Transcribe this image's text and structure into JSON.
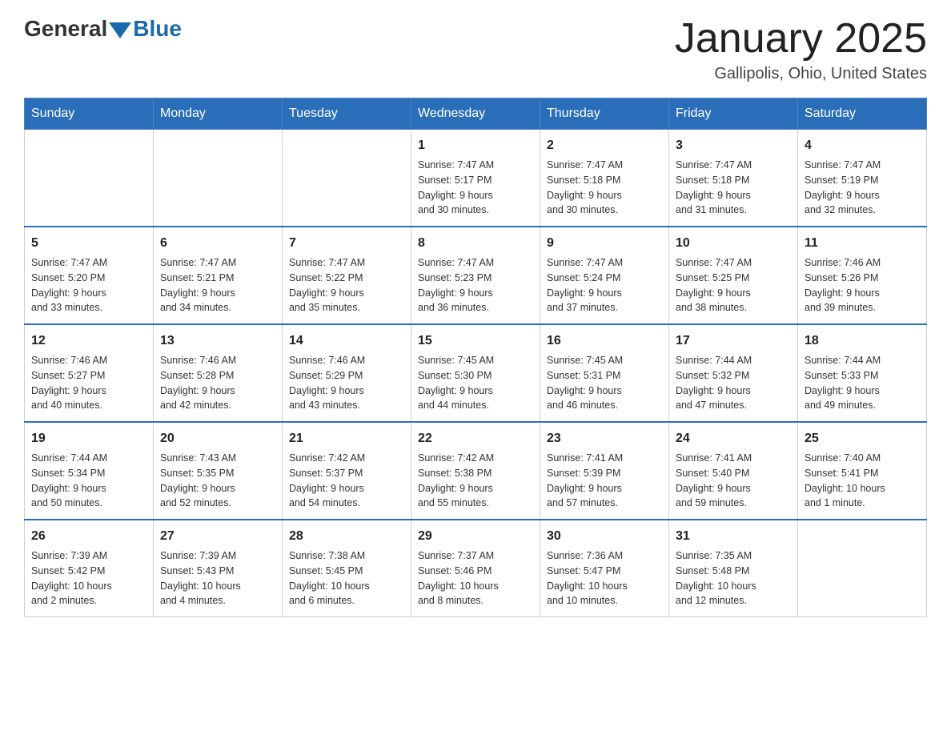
{
  "header": {
    "logo_general": "General",
    "logo_blue": "Blue",
    "month_title": "January 2025",
    "location": "Gallipolis, Ohio, United States"
  },
  "days_of_week": [
    "Sunday",
    "Monday",
    "Tuesday",
    "Wednesday",
    "Thursday",
    "Friday",
    "Saturday"
  ],
  "weeks": [
    [
      {
        "day": "",
        "info": ""
      },
      {
        "day": "",
        "info": ""
      },
      {
        "day": "",
        "info": ""
      },
      {
        "day": "1",
        "info": "Sunrise: 7:47 AM\nSunset: 5:17 PM\nDaylight: 9 hours\nand 30 minutes."
      },
      {
        "day": "2",
        "info": "Sunrise: 7:47 AM\nSunset: 5:18 PM\nDaylight: 9 hours\nand 30 minutes."
      },
      {
        "day": "3",
        "info": "Sunrise: 7:47 AM\nSunset: 5:18 PM\nDaylight: 9 hours\nand 31 minutes."
      },
      {
        "day": "4",
        "info": "Sunrise: 7:47 AM\nSunset: 5:19 PM\nDaylight: 9 hours\nand 32 minutes."
      }
    ],
    [
      {
        "day": "5",
        "info": "Sunrise: 7:47 AM\nSunset: 5:20 PM\nDaylight: 9 hours\nand 33 minutes."
      },
      {
        "day": "6",
        "info": "Sunrise: 7:47 AM\nSunset: 5:21 PM\nDaylight: 9 hours\nand 34 minutes."
      },
      {
        "day": "7",
        "info": "Sunrise: 7:47 AM\nSunset: 5:22 PM\nDaylight: 9 hours\nand 35 minutes."
      },
      {
        "day": "8",
        "info": "Sunrise: 7:47 AM\nSunset: 5:23 PM\nDaylight: 9 hours\nand 36 minutes."
      },
      {
        "day": "9",
        "info": "Sunrise: 7:47 AM\nSunset: 5:24 PM\nDaylight: 9 hours\nand 37 minutes."
      },
      {
        "day": "10",
        "info": "Sunrise: 7:47 AM\nSunset: 5:25 PM\nDaylight: 9 hours\nand 38 minutes."
      },
      {
        "day": "11",
        "info": "Sunrise: 7:46 AM\nSunset: 5:26 PM\nDaylight: 9 hours\nand 39 minutes."
      }
    ],
    [
      {
        "day": "12",
        "info": "Sunrise: 7:46 AM\nSunset: 5:27 PM\nDaylight: 9 hours\nand 40 minutes."
      },
      {
        "day": "13",
        "info": "Sunrise: 7:46 AM\nSunset: 5:28 PM\nDaylight: 9 hours\nand 42 minutes."
      },
      {
        "day": "14",
        "info": "Sunrise: 7:46 AM\nSunset: 5:29 PM\nDaylight: 9 hours\nand 43 minutes."
      },
      {
        "day": "15",
        "info": "Sunrise: 7:45 AM\nSunset: 5:30 PM\nDaylight: 9 hours\nand 44 minutes."
      },
      {
        "day": "16",
        "info": "Sunrise: 7:45 AM\nSunset: 5:31 PM\nDaylight: 9 hours\nand 46 minutes."
      },
      {
        "day": "17",
        "info": "Sunrise: 7:44 AM\nSunset: 5:32 PM\nDaylight: 9 hours\nand 47 minutes."
      },
      {
        "day": "18",
        "info": "Sunrise: 7:44 AM\nSunset: 5:33 PM\nDaylight: 9 hours\nand 49 minutes."
      }
    ],
    [
      {
        "day": "19",
        "info": "Sunrise: 7:44 AM\nSunset: 5:34 PM\nDaylight: 9 hours\nand 50 minutes."
      },
      {
        "day": "20",
        "info": "Sunrise: 7:43 AM\nSunset: 5:35 PM\nDaylight: 9 hours\nand 52 minutes."
      },
      {
        "day": "21",
        "info": "Sunrise: 7:42 AM\nSunset: 5:37 PM\nDaylight: 9 hours\nand 54 minutes."
      },
      {
        "day": "22",
        "info": "Sunrise: 7:42 AM\nSunset: 5:38 PM\nDaylight: 9 hours\nand 55 minutes."
      },
      {
        "day": "23",
        "info": "Sunrise: 7:41 AM\nSunset: 5:39 PM\nDaylight: 9 hours\nand 57 minutes."
      },
      {
        "day": "24",
        "info": "Sunrise: 7:41 AM\nSunset: 5:40 PM\nDaylight: 9 hours\nand 59 minutes."
      },
      {
        "day": "25",
        "info": "Sunrise: 7:40 AM\nSunset: 5:41 PM\nDaylight: 10 hours\nand 1 minute."
      }
    ],
    [
      {
        "day": "26",
        "info": "Sunrise: 7:39 AM\nSunset: 5:42 PM\nDaylight: 10 hours\nand 2 minutes."
      },
      {
        "day": "27",
        "info": "Sunrise: 7:39 AM\nSunset: 5:43 PM\nDaylight: 10 hours\nand 4 minutes."
      },
      {
        "day": "28",
        "info": "Sunrise: 7:38 AM\nSunset: 5:45 PM\nDaylight: 10 hours\nand 6 minutes."
      },
      {
        "day": "29",
        "info": "Sunrise: 7:37 AM\nSunset: 5:46 PM\nDaylight: 10 hours\nand 8 minutes."
      },
      {
        "day": "30",
        "info": "Sunrise: 7:36 AM\nSunset: 5:47 PM\nDaylight: 10 hours\nand 10 minutes."
      },
      {
        "day": "31",
        "info": "Sunrise: 7:35 AM\nSunset: 5:48 PM\nDaylight: 10 hours\nand 12 minutes."
      },
      {
        "day": "",
        "info": ""
      }
    ]
  ]
}
